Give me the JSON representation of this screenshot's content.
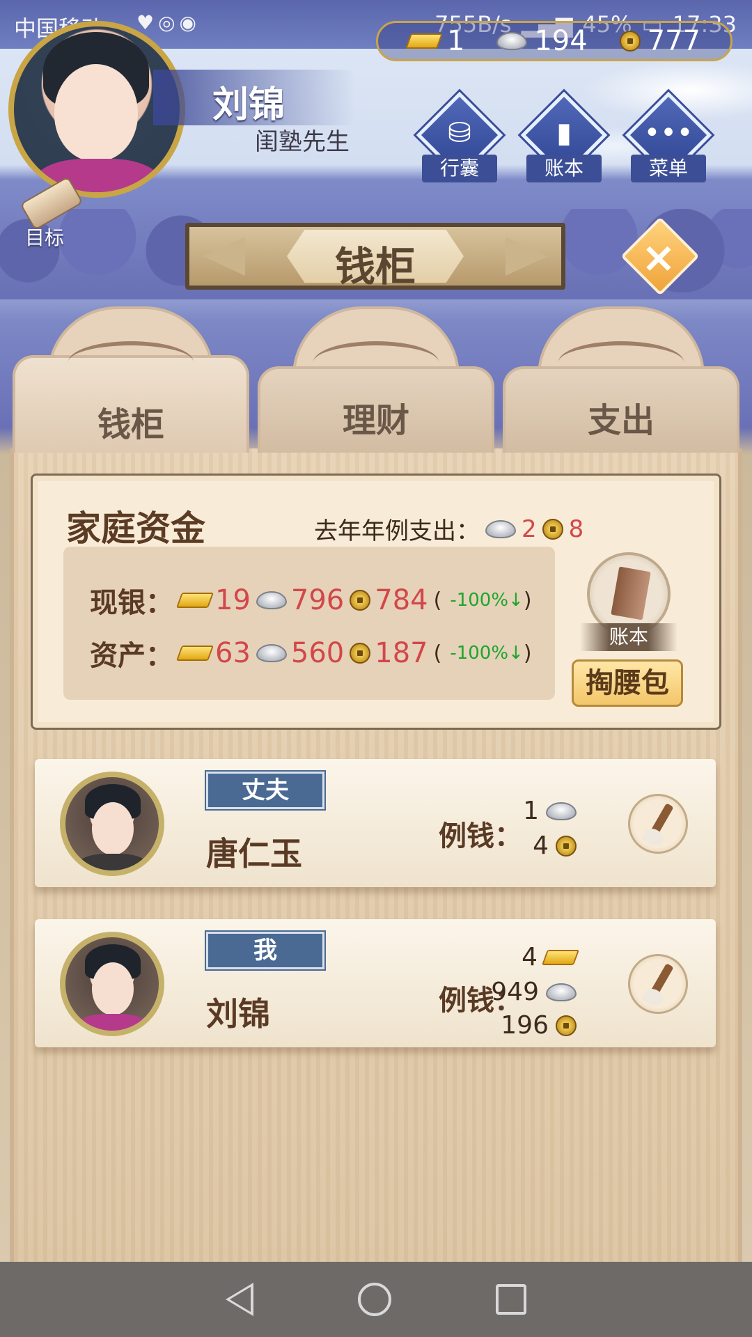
{
  "status_bar": {
    "carrier": "中国移动",
    "net_speed": "755B/s",
    "battery": "45%",
    "time": "17:33"
  },
  "currency": {
    "gold": "1",
    "silver": "194",
    "copper": "777"
  },
  "player": {
    "name": "刘锦",
    "title": "闺塾先生"
  },
  "goal_label": "目标",
  "top_buttons": {
    "bag": "行囊",
    "ledger": "账本",
    "menu": "菜单"
  },
  "page_title": "钱柜",
  "tabs": [
    {
      "label": "钱柜",
      "active": true
    },
    {
      "label": "理财",
      "active": false
    },
    {
      "label": "支出",
      "active": false
    }
  ],
  "family_funds": {
    "title": "家庭资金",
    "last_year_label": "去年年例支出：",
    "last_year_silver": "2",
    "last_year_copper": "8",
    "cash": {
      "label": "现银：",
      "gold": "19",
      "silver": "796",
      "copper": "784",
      "change": "-100%↓"
    },
    "assets": {
      "label": "资产：",
      "gold": "63",
      "silver": "560",
      "copper": "187",
      "change": "-100%↓"
    },
    "ledger_label": "账本",
    "pocket_button": "掏腰包"
  },
  "members": [
    {
      "role": "丈夫",
      "name": "唐仁玉",
      "allowance_label": "例钱：",
      "silver": "1",
      "copper": "4"
    },
    {
      "role": "我",
      "name": "刘锦",
      "allowance_label": "例钱：",
      "gold": "4",
      "silver": "949",
      "copper": "196"
    }
  ],
  "colors": {
    "accent_red": "#d2474b",
    "change_green": "#1ea52f",
    "role_badge": "#4a6a94",
    "pocket_button": "#f3c66a"
  }
}
